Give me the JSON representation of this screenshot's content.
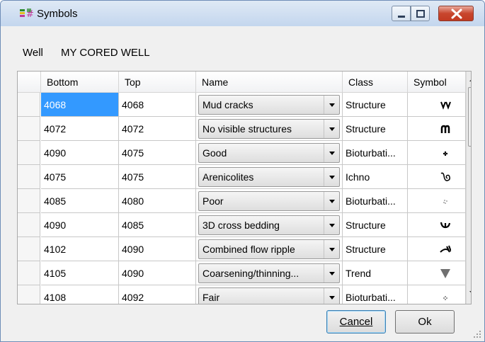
{
  "window": {
    "title": "Symbols",
    "icons": {
      "app": "symbols-app-icon",
      "minimize": "minimize-icon",
      "maximize": "maximize-icon",
      "close": "close-icon"
    }
  },
  "well": {
    "label": "Well",
    "value": "MY CORED WELL"
  },
  "grid": {
    "columns": [
      "Bottom",
      "Top",
      "Name",
      "Class",
      "Symbol"
    ],
    "selected_cell": "Bottom of first row",
    "rows": [
      {
        "bottom": "4068",
        "top": "4068",
        "name": "Mud cracks",
        "class": "Structure",
        "symbol": "mud-cracks-symbol"
      },
      {
        "bottom": "4072",
        "top": "4072",
        "name": "No visible structures",
        "class": "Structure",
        "symbol": "no-visible-structures-symbol"
      },
      {
        "bottom": "4090",
        "top": "4075",
        "name": "Good",
        "class": "Bioturbati...",
        "symbol": "good-bioturbation-symbol"
      },
      {
        "bottom": "4075",
        "top": "4075",
        "name": "Arenicolites",
        "class": "Ichno",
        "symbol": "arenicolites-symbol"
      },
      {
        "bottom": "4085",
        "top": "4080",
        "name": "Poor",
        "class": "Bioturbati...",
        "symbol": "poor-bioturbation-symbol"
      },
      {
        "bottom": "4090",
        "top": "4085",
        "name": "3D cross bedding",
        "class": "Structure",
        "symbol": "cross-bedding-symbol"
      },
      {
        "bottom": "4102",
        "top": "4090",
        "name": "Combined flow ripple",
        "class": "Structure",
        "symbol": "combined-flow-ripple-symbol"
      },
      {
        "bottom": "4105",
        "top": "4090",
        "name": "Coarsening/thinning...",
        "class": "Trend",
        "symbol": "down-triangle-symbol"
      },
      {
        "bottom": "4108",
        "top": "4092",
        "name": "Fair",
        "class": "Bioturbati...",
        "symbol": "fair-bioturbation-symbol"
      }
    ]
  },
  "buttons": {
    "cancel": "Cancel",
    "ok": "Ok"
  },
  "colors": {
    "selection": "#3399ff",
    "close_button": "#c8462d",
    "title_bar": "#c3d6ee"
  }
}
